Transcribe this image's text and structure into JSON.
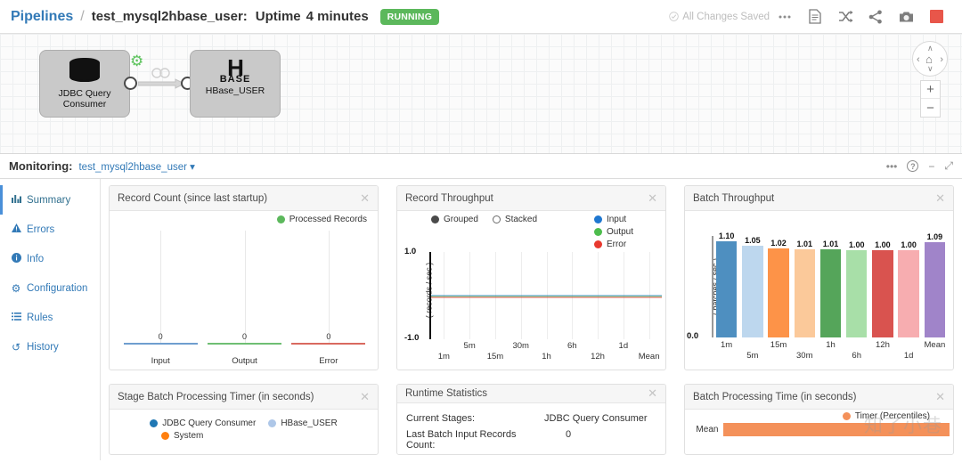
{
  "topbar": {
    "breadcrumb_root": "Pipelines",
    "separator": "/",
    "pipeline_name": "test_mysql2hbase_user:",
    "uptime_label": "Uptime",
    "uptime_value": "4 minutes",
    "status_badge": "RUNNING",
    "status_color": "#5cb85c",
    "saved_text": "All Changes Saved",
    "saved_check_icon": "check-circle-icon",
    "icons": [
      {
        "name": "more-options-icon",
        "glyph": "•••"
      },
      {
        "name": "preview-document-icon",
        "glyph": "▤"
      },
      {
        "name": "snapshot-shuffle-icon",
        "glyph": "⤨"
      },
      {
        "name": "share-icon",
        "glyph": "≪"
      },
      {
        "name": "camera-icon",
        "glyph": "▣"
      },
      {
        "name": "stop-pipeline-icon",
        "glyph": ""
      }
    ],
    "stop_color": "#e8564a"
  },
  "canvas": {
    "stages": [
      {
        "name": "JDBC Query Consumer",
        "label_line1": "JDBC Query",
        "label_line2": "Consumer",
        "icon": "database-icon",
        "config_icon": "gear-icon"
      },
      {
        "name": "HBase_USER",
        "icon_text": "H",
        "icon_sub": "BASE",
        "label_line1": "HBase_USER",
        "label_line2": ""
      }
    ],
    "nav": {
      "up": "∧",
      "down": "∨",
      "left": "‹",
      "right": "›",
      "home": "⌂",
      "zoom_in": "+",
      "zoom_out": "−"
    }
  },
  "monitoring": {
    "title": "Monitoring:",
    "pipeline": "test_mysql2hbase_user",
    "dropdown_caret": "▾",
    "right_icons": [
      {
        "name": "more-options-icon",
        "glyph": "•••"
      },
      {
        "name": "help-icon",
        "glyph": "?"
      },
      {
        "name": "minimize-icon",
        "glyph": "−"
      },
      {
        "name": "expand-icon",
        "glyph": "⤢"
      }
    ]
  },
  "sidebar": {
    "items": [
      {
        "label": "Summary",
        "icon": "bar-chart-icon",
        "glyph": "█▃",
        "active": true
      },
      {
        "label": "Errors",
        "icon": "warning-triangle-icon",
        "glyph": "⚠",
        "active": false
      },
      {
        "label": "Info",
        "icon": "info-circle-icon",
        "glyph": "ℹ",
        "active": false
      },
      {
        "label": "Configuration",
        "icon": "gear-icon",
        "glyph": "⚙",
        "active": false
      },
      {
        "label": "Rules",
        "icon": "list-icon",
        "glyph": "☰",
        "active": false
      },
      {
        "label": "History",
        "icon": "history-icon",
        "glyph": "↺",
        "active": false
      }
    ]
  },
  "panels": {
    "record_count": {
      "title": "Record Count (since last startup)",
      "close_icon": "close-icon",
      "legend": [
        {
          "label": "Processed Records",
          "color": "#5cb85c"
        }
      ]
    },
    "record_throughput": {
      "title": "Record Throughput",
      "close_icon": "close-icon",
      "modes": [
        {
          "label": "Grouped",
          "selected": true
        },
        {
          "label": "Stacked",
          "selected": false
        }
      ],
      "legend": [
        {
          "label": "Input",
          "color": "#1f77d0"
        },
        {
          "label": "Output",
          "color": "#4dbd4d"
        },
        {
          "label": "Error",
          "color": "#e8392f"
        }
      ]
    },
    "batch_throughput": {
      "title": "Batch Throughput",
      "close_icon": "close-icon"
    },
    "stage_batch_timer": {
      "title": "Stage Batch Processing Timer (in seconds)",
      "close_icon": "close-icon",
      "legend": [
        {
          "label": "JDBC Query Consumer",
          "color": "#1f77b4"
        },
        {
          "label": "HBase_USER",
          "color": "#aec7e8"
        },
        {
          "label": "System",
          "color": "#ff7f0e"
        }
      ]
    },
    "runtime_statistics": {
      "title": "Runtime Statistics",
      "close_icon": "close-icon",
      "rows": [
        {
          "key": "Current Stages:",
          "value": "JDBC Query Consumer"
        },
        {
          "key": "Last Batch Input Records Count:",
          "value": "0"
        }
      ]
    },
    "batch_processing_time": {
      "title": "Batch Processing Time (in seconds)",
      "close_icon": "close-icon",
      "legend": [
        {
          "label": "Timer (Percentiles)",
          "color": "#f4915a"
        }
      ],
      "rows": [
        {
          "label": "Mean",
          "color": "#f4915a",
          "width_pct": 88
        }
      ],
      "watermark": "知了小巷"
    }
  },
  "chart_data": [
    {
      "type": "bar",
      "id": "record-count",
      "title": "Record Count (since last startup)",
      "categories": [
        "Input",
        "Output",
        "Error"
      ],
      "values": [
        0,
        0,
        0
      ],
      "value_labels": [
        "0",
        "0",
        "0"
      ],
      "colors": [
        "#6f9ecf",
        "#6fbf73",
        "#d9695f"
      ],
      "legend": [
        "Processed Records"
      ],
      "xlabel": "",
      "ylabel": "",
      "grid": true
    },
    {
      "type": "line",
      "id": "record-throughput",
      "title": "Record Throughput",
      "x": [
        "1m",
        "5m",
        "15m",
        "30m",
        "1h",
        "6h",
        "12h",
        "1d",
        "Mean"
      ],
      "series": [
        {
          "name": "Input",
          "color": "#1f77d0",
          "values": [
            0,
            0,
            0,
            0,
            0,
            0,
            0,
            0,
            0
          ]
        },
        {
          "name": "Output",
          "color": "#4dbd4d",
          "values": [
            0,
            0,
            0,
            0,
            0,
            0,
            0,
            0,
            0
          ]
        },
        {
          "name": "Error",
          "color": "#e8392f",
          "values": [
            0,
            0,
            0,
            0,
            0,
            0,
            0,
            0,
            0
          ]
        }
      ],
      "ylabel": "( records / sec )",
      "ylim": [
        -1.0,
        1.0
      ],
      "yticks": [
        "1.0",
        "-1.0"
      ],
      "grid": true,
      "legend_position": "top-right"
    },
    {
      "type": "bar",
      "id": "batch-throughput",
      "title": "Batch Throughput",
      "categories": [
        "1m",
        "5m",
        "15m",
        "30m",
        "1h",
        "6h",
        "12h",
        "1d",
        "Mean"
      ],
      "values": [
        1.1,
        1.05,
        1.02,
        1.01,
        1.01,
        1.0,
        1.0,
        1.0,
        1.09
      ],
      "value_labels": [
        "1.10",
        "1.05",
        "1.02",
        "1.01",
        "1.01",
        "1.00",
        "1.00",
        "1.00",
        "1.09"
      ],
      "colors": [
        "#4e8fc0",
        "#bdd7ee",
        "#fd9348",
        "#fbc99a",
        "#55a55a",
        "#a8dfa8",
        "#d9534f",
        "#f7adb0",
        "#a084c9"
      ],
      "ylabel": "( batches / sec )",
      "ylim": [
        0.0,
        1.1
      ],
      "yticks": [
        "0.0"
      ],
      "grid": false
    },
    {
      "type": "bar",
      "id": "batch-processing-time",
      "title": "Batch Processing Time (in seconds)",
      "categories": [
        "Mean"
      ],
      "values": [
        88
      ],
      "colors": [
        "#f4915a"
      ],
      "legend": [
        "Timer (Percentiles)"
      ],
      "grid": false
    }
  ]
}
